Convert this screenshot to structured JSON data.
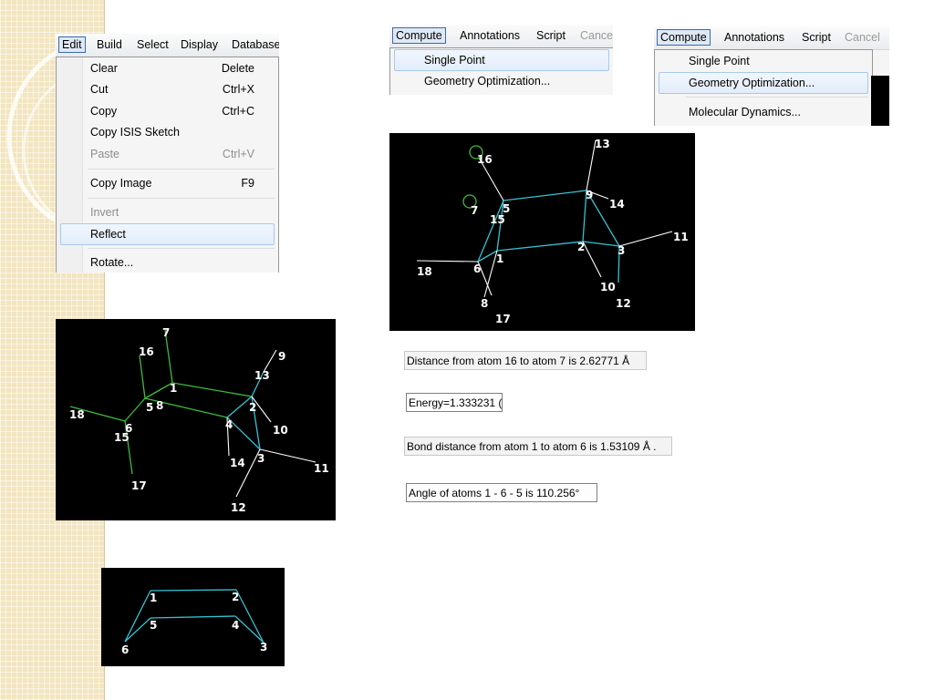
{
  "edit_menu": {
    "menubar": [
      "Edit",
      "Build",
      "Select",
      "Display",
      "Database"
    ],
    "items": [
      {
        "label": "Clear",
        "shortcut": "Delete",
        "disabled": false
      },
      {
        "label": "Cut",
        "shortcut": "Ctrl+X",
        "disabled": false
      },
      {
        "label": "Copy",
        "shortcut": "Ctrl+C",
        "disabled": false
      },
      {
        "label": "Copy ISIS Sketch",
        "shortcut": "",
        "disabled": false
      },
      {
        "label": "Paste",
        "shortcut": "Ctrl+V",
        "disabled": true
      },
      {
        "label": "Copy Image",
        "shortcut": "F9",
        "disabled": false
      },
      {
        "label": "Invert",
        "shortcut": "",
        "disabled": true
      },
      {
        "label": "Reflect",
        "shortcut": "",
        "disabled": false
      },
      {
        "label": "Rotate...",
        "shortcut": "",
        "disabled": false
      }
    ]
  },
  "compute_menu_1": {
    "menubar": [
      "Compute",
      "Annotations",
      "Script",
      "Cance"
    ],
    "items": [
      "Single Point",
      "Geometry Optimization..."
    ]
  },
  "compute_menu_2": {
    "menubar": [
      "Compute",
      "Annotations",
      "Script",
      "Cancel"
    ],
    "items": [
      "Single Point",
      "Geometry Optimization...",
      "Molecular Dynamics..."
    ]
  },
  "molecule_cyan": {
    "labels": [
      "13",
      "16",
      "9",
      "14",
      "7",
      "5",
      "15",
      "11",
      "1",
      "2",
      "3",
      "18",
      "6",
      "10",
      "8",
      "12",
      "17"
    ]
  },
  "molecule_green": {
    "labels": [
      "7",
      "9",
      "16",
      "13",
      "1",
      "2",
      "5",
      "8",
      "18",
      "6",
      "4",
      "10",
      "15",
      "3",
      "14",
      "11",
      "17",
      "12"
    ]
  },
  "ring": {
    "labels": [
      "1",
      "2",
      "5",
      "4",
      "6",
      "3"
    ]
  },
  "readouts": {
    "distance": "Distance from atom  16 to atom  7 is 2.62771 Å",
    "energy": "Energy=1.333231 (",
    "bond": "Bond distance from atom  1 to atom  6 is 1.53109 Å .",
    "angle": "Angle of atoms  1 -  6 -  5 is 110.256°"
  },
  "colors": {
    "molecule_bond": "#35c3d3",
    "molecule_bond_green": "#3dbb3d",
    "hydrogen_bond": "#ffffff",
    "selection_circle": "#3dbb3d",
    "menu_highlight": "#dfe9f5",
    "side_strip": "#f2e5bf"
  }
}
